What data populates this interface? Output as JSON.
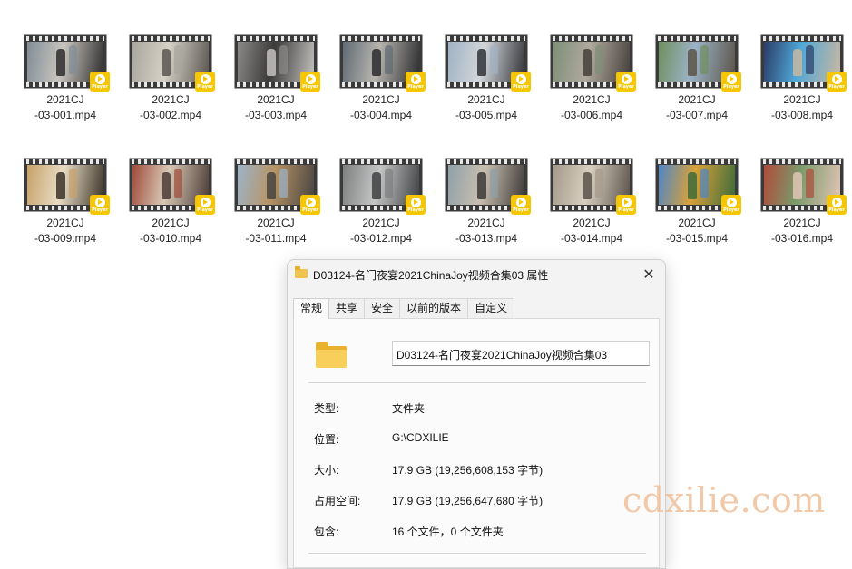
{
  "files": [
    {
      "line1": "2021CJ",
      "line2": "-03-001.mp4",
      "colors": [
        "#7f8d97",
        "#c9c4bd",
        "#2d2d2d"
      ]
    },
    {
      "line1": "2021CJ",
      "line2": "-03-002.mp4",
      "colors": [
        "#a8a69d",
        "#d6d1c6",
        "#5a5650"
      ]
    },
    {
      "line1": "2021CJ",
      "line2": "-03-003.mp4",
      "colors": [
        "#8b8a88",
        "#3d3b3a",
        "#c4c2bf"
      ]
    },
    {
      "line1": "2021CJ",
      "line2": "-03-004.mp4",
      "colors": [
        "#5f6b74",
        "#b7b4ae",
        "#2c2c2e"
      ]
    },
    {
      "line1": "2021CJ",
      "line2": "-03-005.mp4",
      "colors": [
        "#9fb2c3",
        "#d2d6da",
        "#303236"
      ]
    },
    {
      "line1": "2021CJ",
      "line2": "-03-006.mp4",
      "colors": [
        "#7d8f77",
        "#b0a99e",
        "#45403b"
      ]
    },
    {
      "line1": "2021CJ",
      "line2": "-03-007.mp4",
      "colors": [
        "#6f8f5e",
        "#9bb3c7",
        "#5a5347"
      ]
    },
    {
      "line1": "2021CJ",
      "line2": "-03-008.mp4",
      "colors": [
        "#2a3c66",
        "#4fa7d7",
        "#c9b7a0"
      ]
    },
    {
      "line1": "2021CJ",
      "line2": "-03-009.mp4",
      "colors": [
        "#c7a16a",
        "#e8dcc3",
        "#3b3328"
      ]
    },
    {
      "line1": "2021CJ",
      "line2": "-03-010.mp4",
      "colors": [
        "#a04a3a",
        "#d8c9b6",
        "#4b3b35"
      ]
    },
    {
      "line1": "2021CJ",
      "line2": "-03-011.mp4",
      "colors": [
        "#9cb4c9",
        "#b79466",
        "#494440"
      ]
    },
    {
      "line1": "2021CJ",
      "line2": "-03-012.mp4",
      "colors": [
        "#7d7f80",
        "#c4c6c5",
        "#3f4042"
      ]
    },
    {
      "line1": "2021CJ",
      "line2": "-03-013.mp4",
      "colors": [
        "#8fa0a8",
        "#c8bfb0",
        "#3c3835"
      ]
    },
    {
      "line1": "2021CJ",
      "line2": "-03-014.mp4",
      "colors": [
        "#a59a8a",
        "#d8cfc0",
        "#5b524a"
      ]
    },
    {
      "line1": "2021CJ",
      "line2": "-03-015.mp4",
      "colors": [
        "#4f86c6",
        "#d9a13a",
        "#3c6b3a"
      ]
    },
    {
      "line1": "2021CJ",
      "line2": "-03-016.mp4",
      "colors": [
        "#b24a3c",
        "#7a9a6a",
        "#e2c4b5"
      ]
    }
  ],
  "player_badge": "Player",
  "dialog": {
    "title": "D03124-名门夜宴2021ChinaJoy视频合集03 属性",
    "tabs": [
      "常规",
      "共享",
      "安全",
      "以前的版本",
      "自定义"
    ],
    "folder_name": "D03124-名门夜宴2021ChinaJoy视频合集03",
    "fields": [
      {
        "label": "类型:",
        "value": "文件夹"
      },
      {
        "label": "位置:",
        "value": "G:\\CDXILIE"
      },
      {
        "label": "大小:",
        "value": "17.9 GB (19,256,608,153 字节)"
      },
      {
        "label": "占用空间:",
        "value": "17.9 GB (19,256,647,680 字节)"
      },
      {
        "label": "包含:",
        "value": "16 个文件，0 个文件夹"
      }
    ]
  },
  "watermark": "cdxilie.com"
}
